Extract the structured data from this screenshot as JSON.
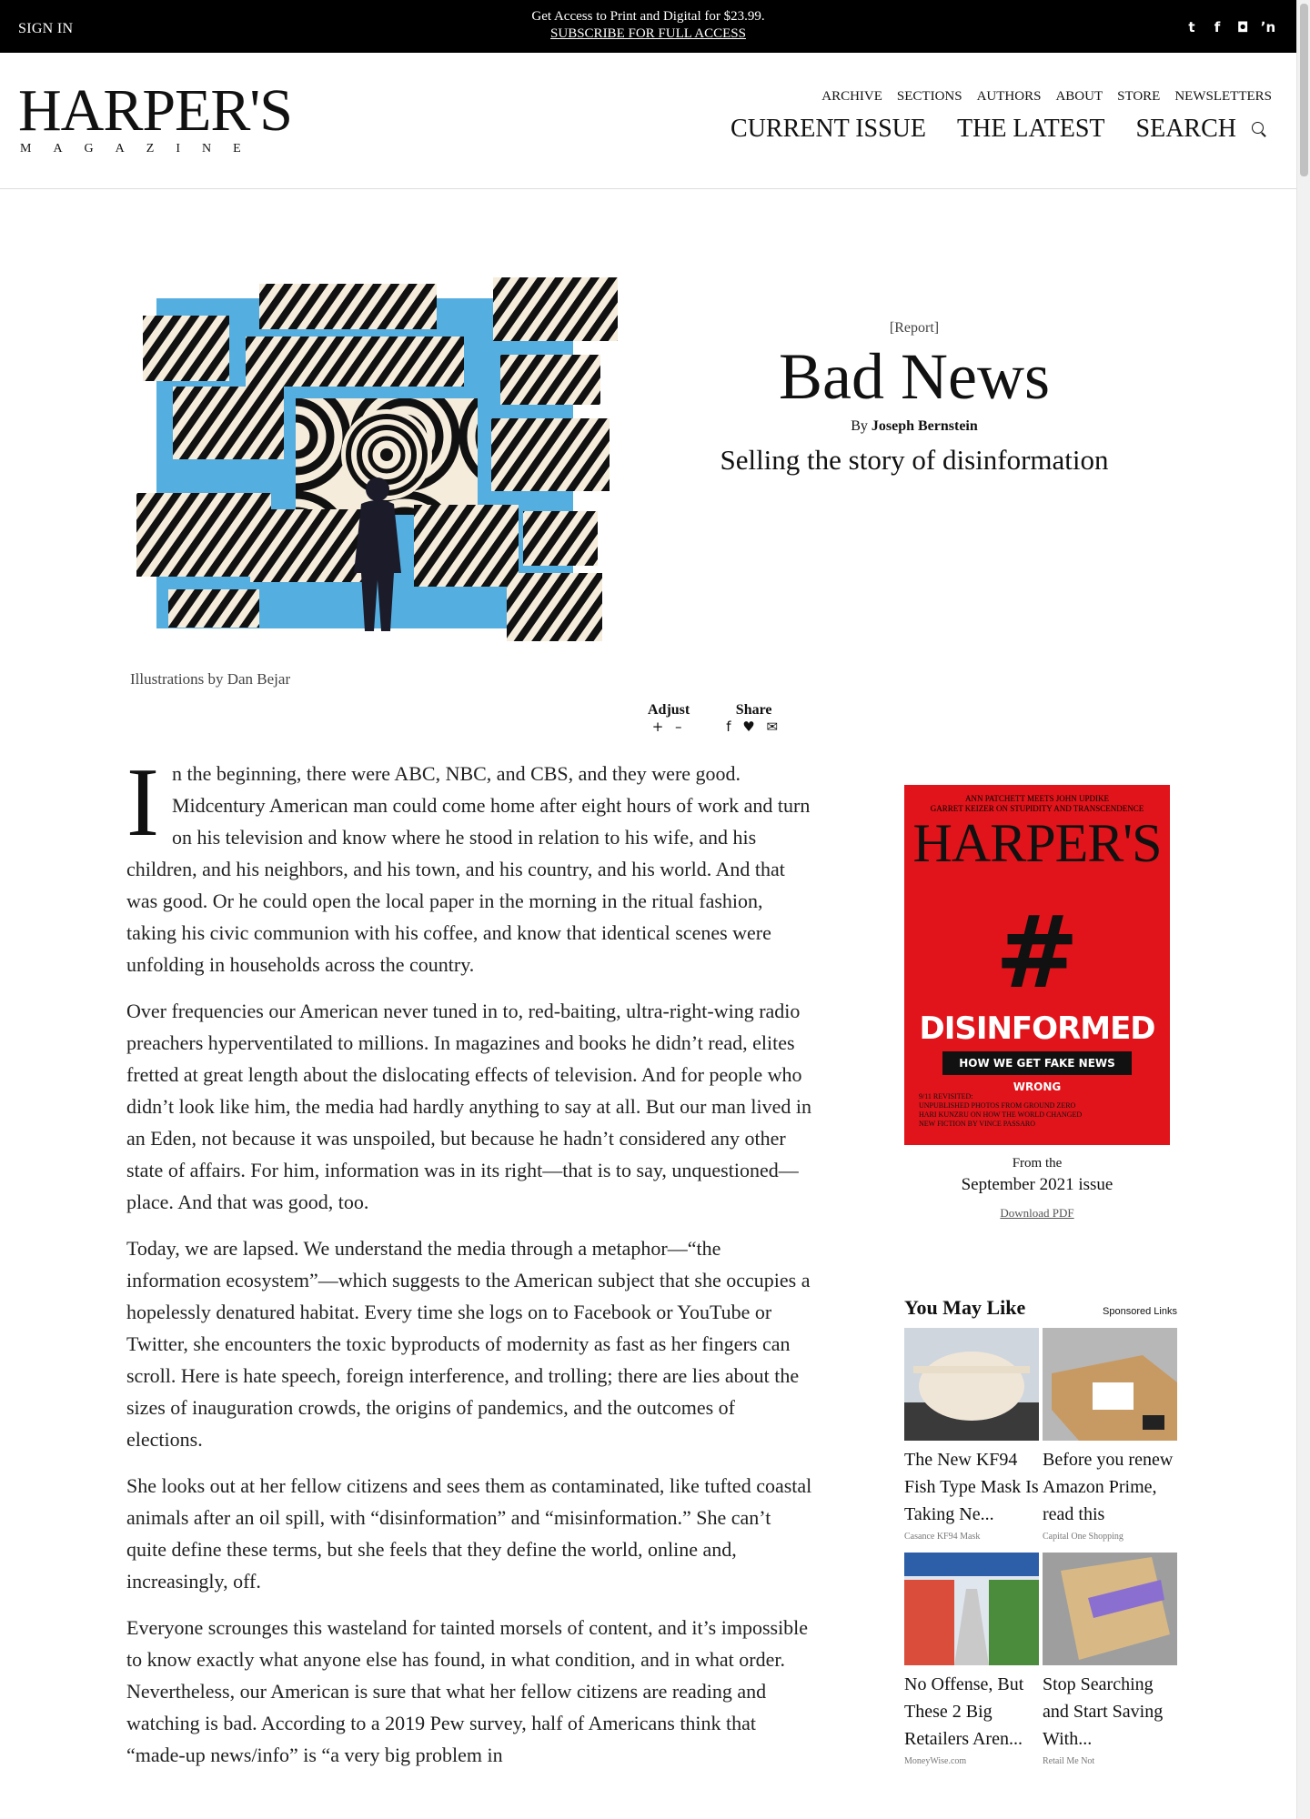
{
  "topbar": {
    "signin": "SIGN IN",
    "promo_line1": "Get Access to Print and Digital for $23.99.",
    "promo_line2": "SUBSCRIBE FOR FULL ACCESS",
    "social": [
      "twitter-icon",
      "facebook-icon",
      "instagram-icon",
      "rss-icon"
    ]
  },
  "header": {
    "logo_big": "HARPER'S",
    "logo_small": "MAGAZINE",
    "small_nav": [
      "ARCHIVE",
      "SECTIONS",
      "AUTHORS",
      "ABOUT",
      "STORE",
      "NEWSLETTERS"
    ],
    "big_nav": [
      "CURRENT ISSUE",
      "THE LATEST",
      "SEARCH"
    ]
  },
  "article": {
    "kicker": "[Report]",
    "title": "Bad News",
    "byline_prefix": "By",
    "author": "Joseph Bernstein",
    "dek": "Selling the story of disinformation",
    "caption": "Illustrations by Dan Bejar",
    "adjust_label": "Adjust",
    "adjust_icons": "+ –",
    "share_label": "Share",
    "share_icons": "f ♥ ✉",
    "dropcap": "I",
    "paragraphs": [
      "n the beginning, there were ABC, NBC, and CBS, and they were good. Midcentury American man could come home after eight hours of work and turn on his television and know where he stood in relation to his wife, and his children, and his neighbors, and his town, and his country, and his world. And that was good. Or he could open the local paper in the morning in the ritual fashion, taking his civic communion with his coffee, and know that identical scenes were unfolding in households across the country.",
      "Over frequencies our American never tuned in to, red-baiting, ultra-right-wing radio preachers hyperventilated to millions. In magazines and books he didn’t read, elites fretted at great length about the dislocating effects of television. And for people who didn’t look like him, the media had hardly anything to say at all. But our man lived in an Eden, not because it was unspoiled, but because he hadn’t considered any other state of affairs. For him, information was in its right—that is to say, unquestioned—place. And that was good, too.",
      "Today, we are lapsed. We understand the media through a metaphor—“the information ecosystem”—which suggests to the American subject that she occupies a hopelessly denatured habitat. Every time she logs on to Facebook or YouTube or Twitter, she encounters the toxic byproducts of modernity as fast as her fingers can scroll. Here is hate speech, foreign interference, and trolling; there are lies about the sizes of inauguration crowds, the origins of pandemics, and the outcomes of elections.",
      "She looks out at her fellow citizens and sees them as contaminated, like tufted coastal animals after an oil spill, with “disinformation” and “misinformation.” She can’t quite define these terms, but she feels that they define the world, online and, increasingly, off.",
      "Everyone scrounges this wasteland for tainted morsels of content, and it’s impossible to know exactly what anyone else has found, in what condition, and in what order. Nevertheless, our American is sure that what her fellow citizens are reading and watching is bad. According to a 2019 Pew survey, half of Americans think that “made-up news/info” is “a very big problem in"
    ]
  },
  "sidebar": {
    "cover_topline1": "ANN PATCHETT MEETS JOHN UPDIKE",
    "cover_topline2": "GARRET KEIZER ON STUPIDITY AND TRANSCENDENCE",
    "cover_mast": "HARPER'S",
    "cover_hash": "#",
    "cover_headline": "DISINFORMED",
    "cover_strap": "HOW WE GET FAKE NEWS WRONG",
    "cover_lines": [
      "9/11 REVISITED:",
      "UNPUBLISHED PHOTOS FROM GROUND ZERO",
      "HARI KUNZRU ON HOW THE WORLD CHANGED",
      "NEW FICTION BY VINCE PASSARO"
    ],
    "from_label": "From the",
    "issue_label": "September 2021 issue",
    "pdf_label": "Download PDF",
    "you_may_like": "You May Like",
    "sponsored": "Sponsored Links",
    "cards": [
      {
        "title": "The New KF94 Fish Type Mask Is Taking Ne...",
        "source": "Casance KF94 Mask"
      },
      {
        "title": "Before you renew Amazon Prime, read this",
        "source": "Capital One Shopping"
      },
      {
        "title": "No Offense, But These 2 Big Retailers Aren...",
        "source": "MoneyWise.com"
      },
      {
        "title": "Stop Searching and Start Saving With...",
        "source": "Retail Me Not"
      }
    ]
  },
  "colors": {
    "topbar": "#000000",
    "hero_blue": "#55aee0",
    "cover_red": "#e0141a"
  }
}
